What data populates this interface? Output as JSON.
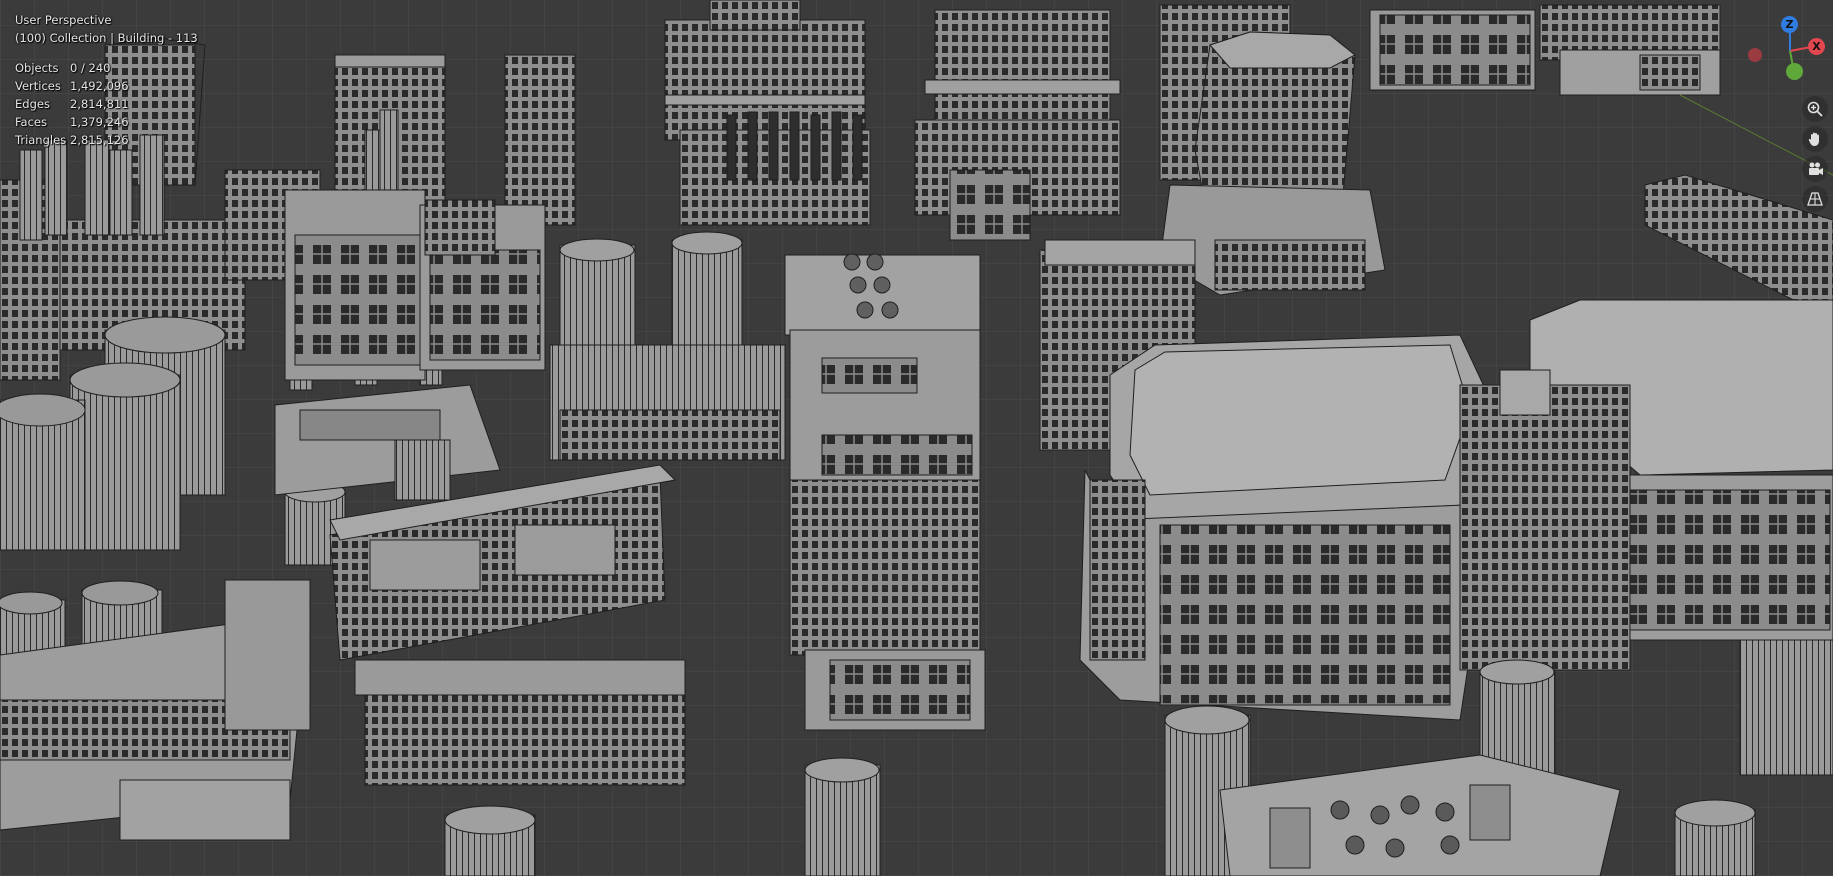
{
  "viewport": {
    "view_name": "User Perspective",
    "collection_label": "(100) Collection | Building - 113",
    "stats": [
      {
        "label": "Objects",
        "value": "0 / 240"
      },
      {
        "label": "Vertices",
        "value": "1,492,096"
      },
      {
        "label": "Edges",
        "value": "2,814,811"
      },
      {
        "label": "Faces",
        "value": "1,379,246"
      },
      {
        "label": "Triangles",
        "value": "2,815,126"
      }
    ]
  },
  "gizmo": {
    "axes": [
      {
        "name": "z",
        "label": "Z",
        "color": "#2f7de0"
      },
      {
        "name": "x",
        "label": "X",
        "color": "#e2474f"
      },
      {
        "name": "y",
        "label": "",
        "color": "#5fa83a"
      },
      {
        "name": "neg-x",
        "label": "",
        "color": "#9a3b42"
      }
    ]
  },
  "tools": [
    {
      "name": "zoom-icon"
    },
    {
      "name": "hand-pan-icon"
    },
    {
      "name": "camera-icon"
    },
    {
      "name": "perspective-grid-icon"
    }
  ]
}
